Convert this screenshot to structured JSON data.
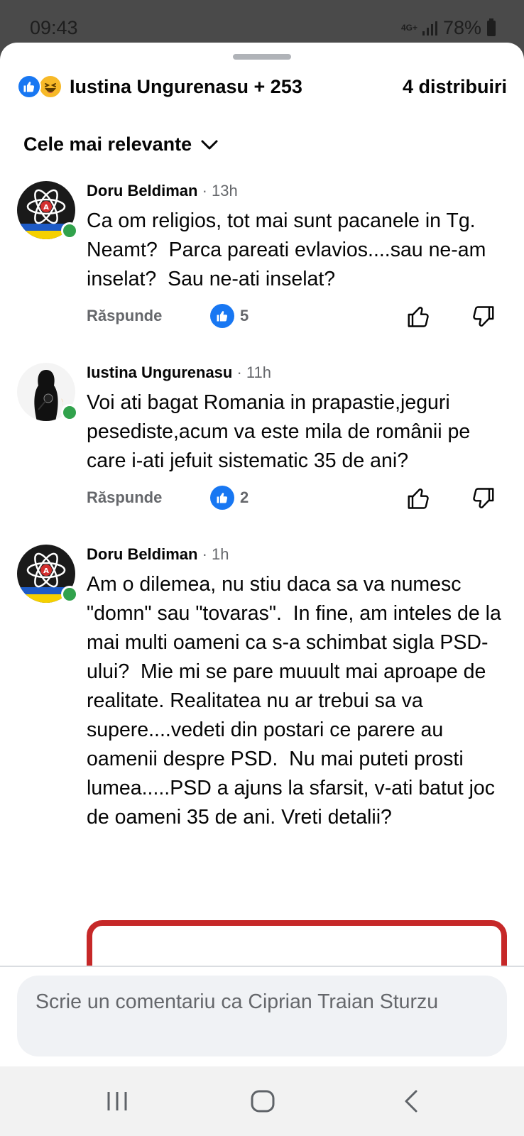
{
  "status_bar": {
    "time": "09:43",
    "network": "4G+",
    "battery": "78%"
  },
  "header": {
    "reactors": "Iustina Ungurenasu + 253",
    "shares": "4 distribuiri",
    "reaction_icons": [
      "like-icon",
      "haha-icon"
    ]
  },
  "sort": {
    "label": "Cele mai relevante"
  },
  "comments": [
    {
      "author": "Doru Beldiman",
      "time": "· 13h",
      "text": "Ca om religios, tot mai sunt pacanele in Tg. Neamt?  Parca pareati evlavios....sau ne-am inselat?  Sau ne-ati inselat?",
      "reply": "Răspunde",
      "likes": "5"
    },
    {
      "author": "Iustina Ungurenasu",
      "time": "· 11h",
      "text": "Voi ati bagat Romania in prapastie,jeguri pesediste,acum va este mila de românii pe care i-ati jefuit sistematic 35 de ani?",
      "reply": "Răspunde",
      "likes": "2"
    },
    {
      "author": "Doru Beldiman",
      "time": "· 1h",
      "text": "Am o dilemea, nu stiu daca sa va numesc \"domn\" sau \"tovaras\".  In fine, am inteles de la mai multi oameni ca s-a schimbat sigla PSD-ului?  Mie mi se pare muuult mai aproape de realitate. Realitatea nu ar trebui sa va supere....vedeti din postari ce parere au oamenii despre PSD.  Nu mai puteti prosti lumea.....PSD a ajuns la sfarsit, v-ati batut joc de oameni 35 de ani. Vreti detalii?"
    }
  ],
  "composer": {
    "placeholder": "Scrie un comentariu ca Ciprian Traian Sturzu"
  },
  "colors": {
    "accent": "#1877f2",
    "online": "#31a24c",
    "attachment_border": "#c62828"
  }
}
